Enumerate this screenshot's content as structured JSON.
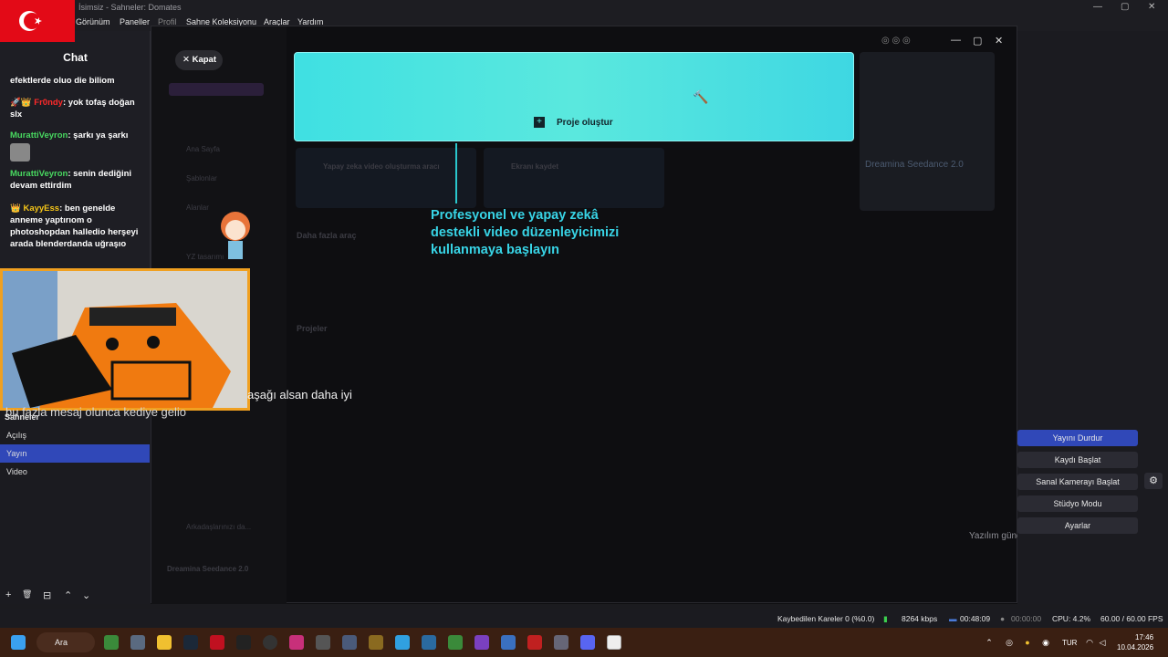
{
  "window": {
    "title": "İsimsiz - Sahneler: Domates",
    "menu": [
      "Görünüm",
      "Paneller",
      "Profil",
      "Sahne Koleksiyonu",
      "Araçlar",
      "Yardım"
    ]
  },
  "chat": {
    "title": "Chat",
    "messages": [
      {
        "user": "",
        "text": "efektlerde oluo die biliom"
      },
      {
        "user": "Fr0ndy",
        "text": ": yok tofaş doğan slx"
      },
      {
        "user": "MurattiVeyron",
        "text": ": şarkı ya şarkı"
      },
      {
        "user": "MurattiVeyron",
        "text": ": senin dediğini devam ettirdim"
      },
      {
        "user": "KayyEss",
        "text": ": ben genelde anneme yaptırıom o photoshopdan halledio herşeyi arada blenderdanda uğraşıo"
      }
    ]
  },
  "overlay": {
    "line1": "aşağı alsan daha iyi",
    "line2": "bu fazla mesaj olunca kediye gelio"
  },
  "scenes": {
    "header": "Sahneler",
    "items": [
      "Açılış",
      "Yayın",
      "Video"
    ],
    "active_index": 1,
    "tools": [
      "+",
      "🗑",
      "⊟",
      "⌃",
      "⌄"
    ]
  },
  "modal": {
    "close_label": "Kapat",
    "create_label": "Proje oluştur",
    "tour_text": "Profesyonel ve yapay zekâ destekli video düzenleyicimizi kullanmaya başlayın",
    "promo_text": "Dreamina Seedance 2.0",
    "sidebar_items": [
      "Ana Sayfa",
      "Şablonlar",
      "Alanlar",
      "YZ tasarımı",
      "Arkadaşlarınızı da...",
      "Dreamina Seedance 2.0"
    ],
    "sections": [
      "Daha fazla araç",
      "Projeler"
    ],
    "tools": [
      "Yapay zeka video oluşturma aracı",
      "Ekranı kaydet"
    ],
    "update_title": "Yazılım güncellemelerini yönetin"
  },
  "controls": {
    "buttons": [
      "Yayını Durdur",
      "Kaydı Başlat",
      "Sanal Kamerayı Başlat",
      "Stüdyo Modu",
      "Ayarlar"
    ]
  },
  "status": {
    "dropped": "Kaybedilen Kareler 0 (%0.0)",
    "bitrate": "8264 kbps",
    "stream_time": "00:48:09",
    "rec_time": "00:00:00",
    "cpu": "CPU: 4.2%",
    "fps": "60.00 / 60.00 FPS"
  },
  "taskbar": {
    "search": "Ara",
    "lang": "TUR",
    "time": "17:46",
    "date": "10.04.2026"
  },
  "colors": {
    "accent": "#3048b8",
    "cyan": "#38d4e6",
    "taskbar": "#3a1f12"
  }
}
